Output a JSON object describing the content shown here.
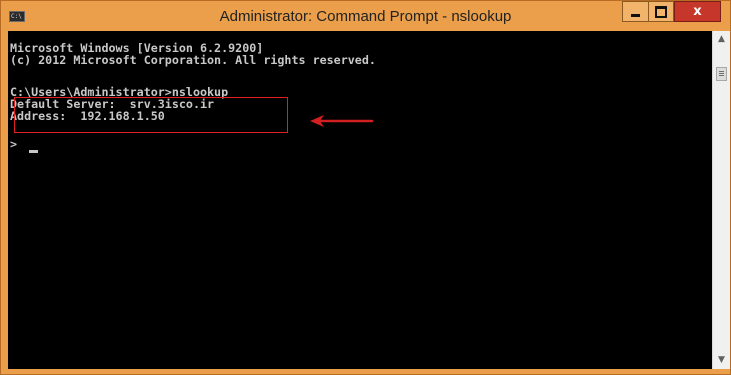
{
  "window": {
    "title": "Administrator: Command Prompt - nslookup",
    "system_icon_text": "C:\\",
    "frame_color": "#eb9f4a",
    "close_color": "#c7362b"
  },
  "controls": {
    "minimize": "minimize-icon",
    "maximize": "maximize-icon",
    "close": "x"
  },
  "console": {
    "lines": [
      "Microsoft Windows [Version 6.2.9200]",
      "(c) 2012 Microsoft Corporation. All rights reserved.",
      "",
      "C:\\Users\\Administrator>nslookup",
      "Default Server:  srv.3isco.ir",
      "Address:  192.168.1.50",
      "",
      ">"
    ],
    "highlight_color": "#e02020",
    "arrow_color": "#d21f1f"
  },
  "scrollbar": {
    "up": "▲",
    "down": "▼"
  }
}
